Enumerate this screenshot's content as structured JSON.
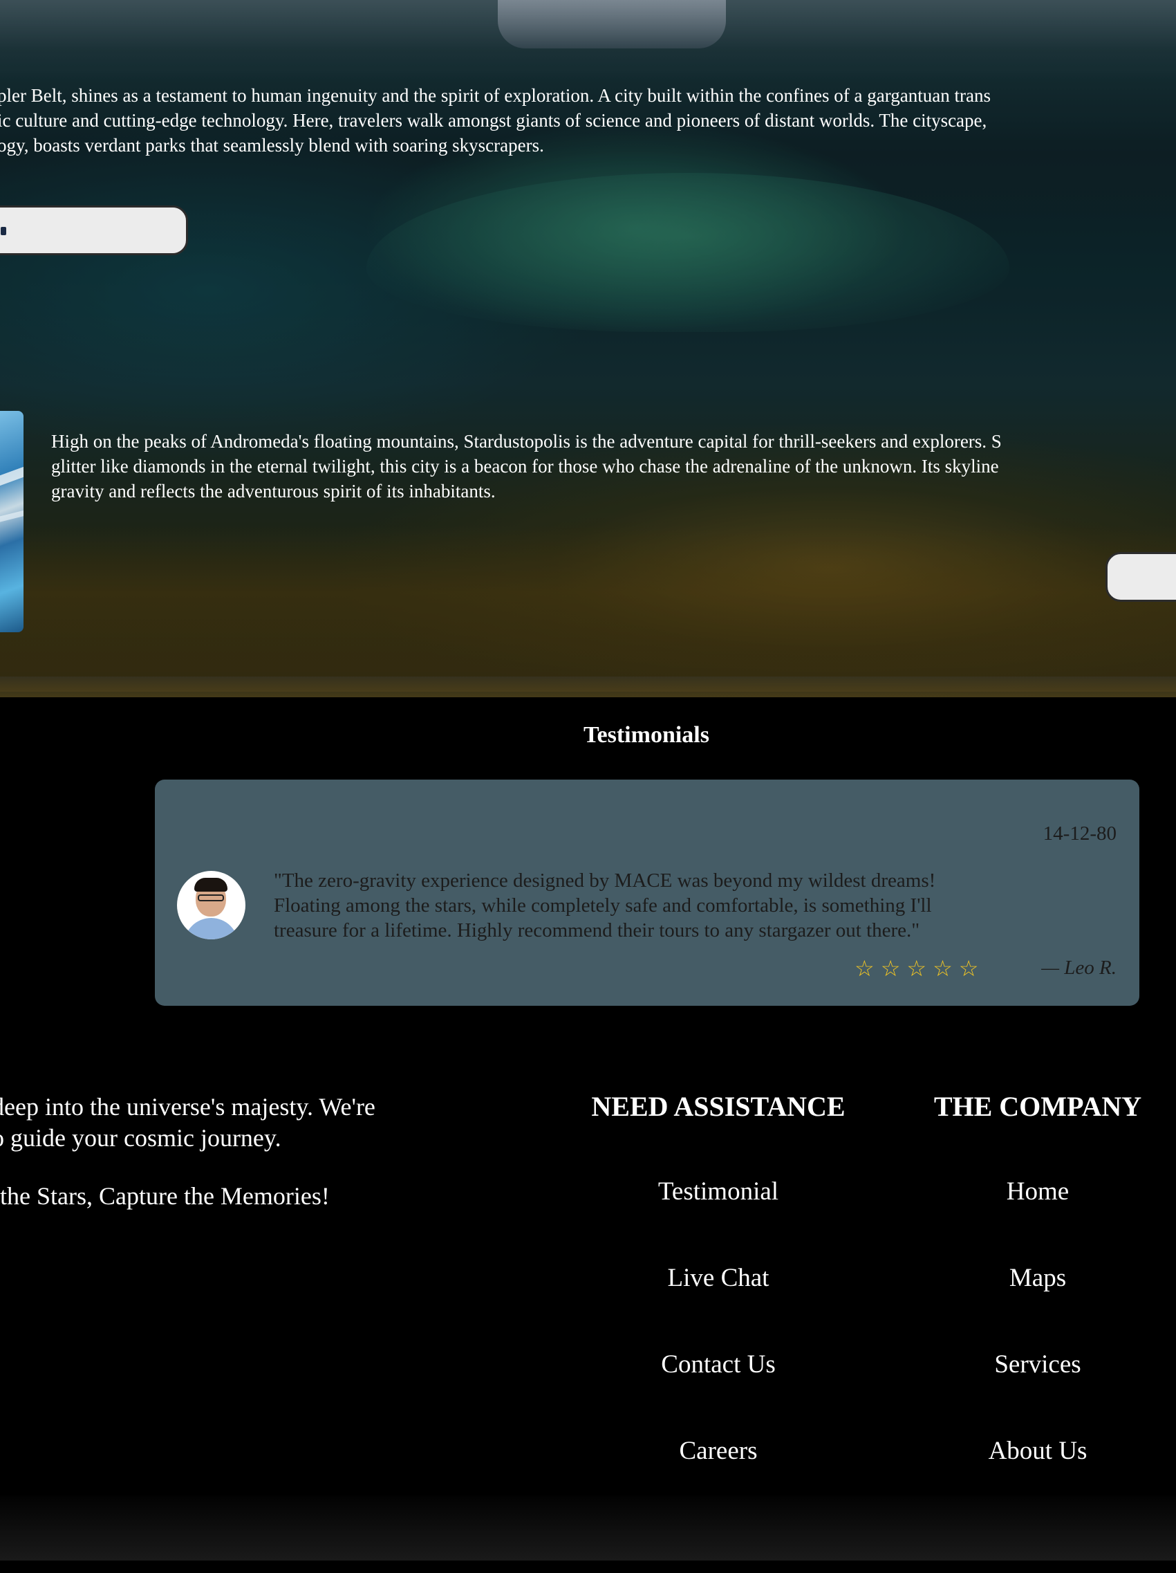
{
  "destinations": [
    {
      "description_lines": [
        "pler Belt, shines as a testament to human ingenuity and the spirit of exploration. A city built within the confines of a gargantuan trans",
        "ic culture and cutting-edge technology. Here, travelers walk amongst giants of science and pioneers of distant worlds. The cityscape, ",
        "ogy, boasts verdant parks that seamlessly blend with soaring skyscrapers."
      ],
      "button_label": ""
    },
    {
      "description_lines": [
        "High on the peaks of Andromeda's floating mountains, Stardustopolis is the adventure capital for thrill-seekers and explorers. S",
        "glitter like diamonds in the eternal twilight, this city is a beacon for those who chase the adrenaline of the unknown. Its skyline",
        "gravity and reflects the adventurous spirit of its inhabitants."
      ],
      "button_label": ""
    }
  ],
  "testimonials": {
    "title": "Testimonials",
    "items": [
      {
        "date": "14-12-80",
        "quote_lines": [
          "\"The zero-gravity experience designed by MACE was beyond my wildest dreams!",
          "Floating among the stars, while completely safe and comfortable, is something I'll",
          "treasure for a lifetime. Highly recommend their tours to any stargazer out there.\""
        ],
        "stars": "☆☆☆☆☆",
        "author": "— Leo R.",
        "star_color": "#f3c623",
        "card_color": "#455c66"
      }
    ]
  },
  "footer": {
    "about_lines": [
      "deep into the universe's majesty. We're",
      "o guide your cosmic journey."
    ],
    "tagline": " the Stars, Capture the Memories!",
    "assistance": {
      "heading": "NEED ASSISTANCE",
      "links": [
        "Testimonial",
        "Live Chat",
        "Contact Us",
        "Careers"
      ]
    },
    "company": {
      "heading": "THE COMPANY",
      "links": [
        "Home",
        "Maps",
        "Services",
        "About Us"
      ]
    }
  }
}
